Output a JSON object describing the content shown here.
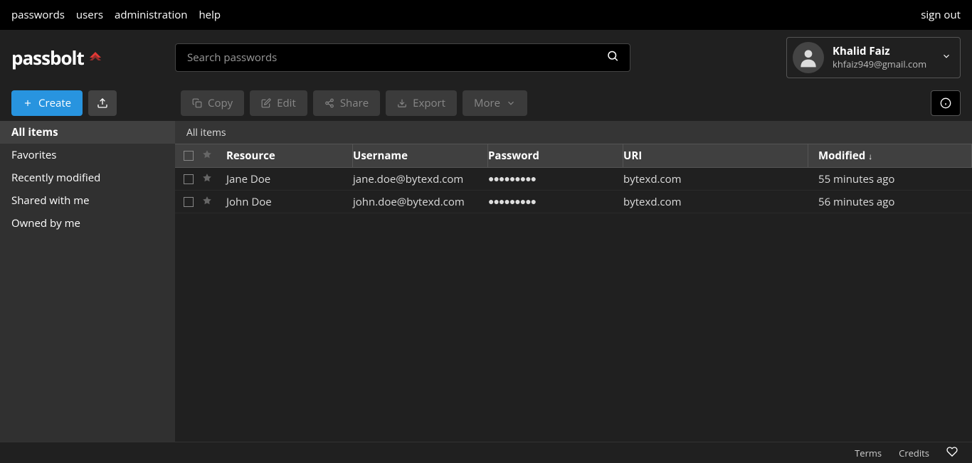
{
  "top_nav": {
    "items": [
      "passwords",
      "users",
      "administration",
      "help"
    ],
    "sign_out": "sign out"
  },
  "logo": {
    "text": "passbolt"
  },
  "search": {
    "placeholder": "Search passwords"
  },
  "user": {
    "name": "Khalid Faiz",
    "email": "khfaiz949@gmail.com"
  },
  "toolbar": {
    "create": "Create",
    "copy": "Copy",
    "edit": "Edit",
    "share": "Share",
    "export": "Export",
    "more": "More"
  },
  "sidebar": {
    "items": [
      {
        "label": "All items",
        "active": true
      },
      {
        "label": "Favorites",
        "active": false
      },
      {
        "label": "Recently modified",
        "active": false
      },
      {
        "label": "Shared with me",
        "active": false
      },
      {
        "label": "Owned by me",
        "active": false
      }
    ]
  },
  "breadcrumb": "All items",
  "table": {
    "headers": {
      "resource": "Resource",
      "username": "Username",
      "password": "Password",
      "uri": "URI",
      "modified": "Modified"
    },
    "rows": [
      {
        "resource": "Jane Doe",
        "username": "jane.doe@bytexd.com",
        "password": "●●●●●●●●●",
        "uri": "bytexd.com",
        "modified": "55 minutes ago"
      },
      {
        "resource": "John Doe",
        "username": "john.doe@bytexd.com",
        "password": "●●●●●●●●●",
        "uri": "bytexd.com",
        "modified": "56 minutes ago"
      }
    ]
  },
  "footer": {
    "terms": "Terms",
    "credits": "Credits"
  }
}
